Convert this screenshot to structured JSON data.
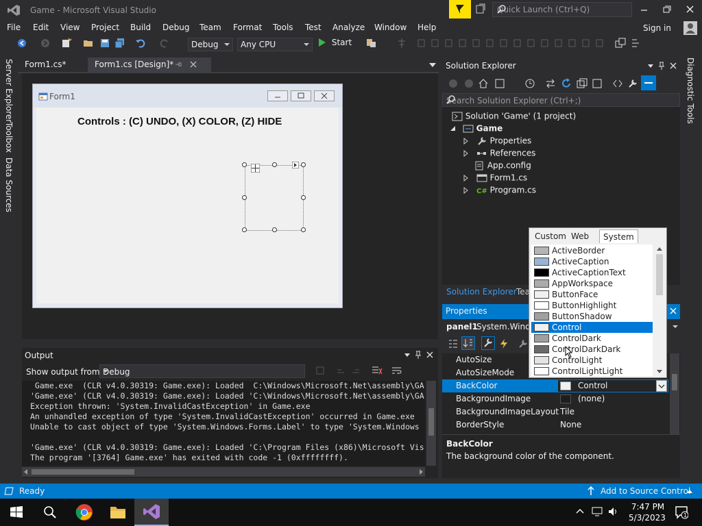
{
  "window": {
    "title": "Game - Microsoft Visual Studio",
    "quick_launch": "Quick Launch (Ctrl+Q)",
    "sign_in": "Sign in"
  },
  "menu": [
    "File",
    "Edit",
    "View",
    "Project",
    "Build",
    "Debug",
    "Team",
    "Format",
    "Tools",
    "Test",
    "Analyze",
    "Window",
    "Help"
  ],
  "toolbar": {
    "config": "Debug",
    "platform": "Any CPU",
    "start": "Start"
  },
  "left_strip": [
    "Server Explorer",
    "Toolbox",
    "Data Sources"
  ],
  "right_strip": [
    "Diagnostic Tools"
  ],
  "doc_tabs": [
    "Form1.cs*",
    "Form1.cs [Design]*"
  ],
  "designer": {
    "form_title": "Form1",
    "label_text": "Controls :  (C) UNDO, (X) COLOR, (Z) HIDE"
  },
  "output": {
    "title": "Output",
    "show_from_label": "Show output from:",
    "source": "Debug",
    "lines": [
      " Game.exe  (CLR v4.0.30319: Game.exe): Loaded  C:\\Windows\\Microsoft.Net\\assembly\\GA",
      "'Game.exe' (CLR v4.0.30319: Game.exe): Loaded 'C:\\Windows\\Microsoft.Net\\assembly\\GA",
      "Exception thrown: 'System.InvalidCastException' in Game.exe",
      "An unhandled exception of type 'System.InvalidCastException' occurred in Game.exe",
      "Unable to cast object of type 'System.Windows.Forms.Label' to type 'System.Windows",
      "",
      "'Game.exe' (CLR v4.0.30319: Game.exe): Loaded 'C:\\Program Files (x86)\\Microsoft Vis",
      "The program '[3764] Game.exe' has exited with code -1 (0xffffffff)."
    ]
  },
  "solution_explorer": {
    "title": "Solution Explorer",
    "search_placeholder": "Search Solution Explorer (Ctrl+;)",
    "solution": "Solution 'Game' (1 project)",
    "project": "Game",
    "items": [
      "Properties",
      "References",
      "App.config",
      "Form1.cs",
      "Program.cs"
    ],
    "bottom_tabs": [
      "Solution Explorer",
      "Tea"
    ]
  },
  "properties": {
    "title": "Properties",
    "object": "panel1",
    "object_type": "System.Windo",
    "rows": [
      {
        "name": "AutoSize",
        "value": ""
      },
      {
        "name": "AutoSizeMode",
        "value": ""
      },
      {
        "name": "BackColor",
        "value": "Control"
      },
      {
        "name": "BackgroundImage",
        "value": "(none)"
      },
      {
        "name": "BackgroundImageLayout",
        "value": "Tile"
      },
      {
        "name": "BorderStyle",
        "value": "None"
      }
    ],
    "desc_title": "BackColor",
    "desc_text": "The background color of the component."
  },
  "color_popup": {
    "tabs": [
      "Custom",
      "Web",
      "System"
    ],
    "selected_tab": "System",
    "items": [
      {
        "name": "ActiveBorder",
        "color": "#b4b4b4"
      },
      {
        "name": "ActiveCaption",
        "color": "#99b4d1"
      },
      {
        "name": "ActiveCaptionText",
        "color": "#000000"
      },
      {
        "name": "AppWorkspace",
        "color": "#ababab"
      },
      {
        "name": "ButtonFace",
        "color": "#f0f0f0"
      },
      {
        "name": "ButtonHighlight",
        "color": "#ffffff"
      },
      {
        "name": "ButtonShadow",
        "color": "#a0a0a0"
      },
      {
        "name": "Control",
        "color": "#f0f0f0"
      },
      {
        "name": "ControlDark",
        "color": "#a0a0a0"
      },
      {
        "name": "ControlDarkDark",
        "color": "#696969"
      },
      {
        "name": "ControlLight",
        "color": "#e3e3e3"
      },
      {
        "name": "ControlLightLight",
        "color": "#ffffff"
      }
    ],
    "selected": "Control"
  },
  "status": {
    "left": "Ready",
    "right": "Add to Source Control"
  },
  "taskbar": {
    "time": "7:47 PM",
    "date": "5/3/2023"
  },
  "colors": {
    "accent": "#007acc",
    "chrome": "#2d2d30",
    "panel": "#252526",
    "flag": "#fde100"
  }
}
